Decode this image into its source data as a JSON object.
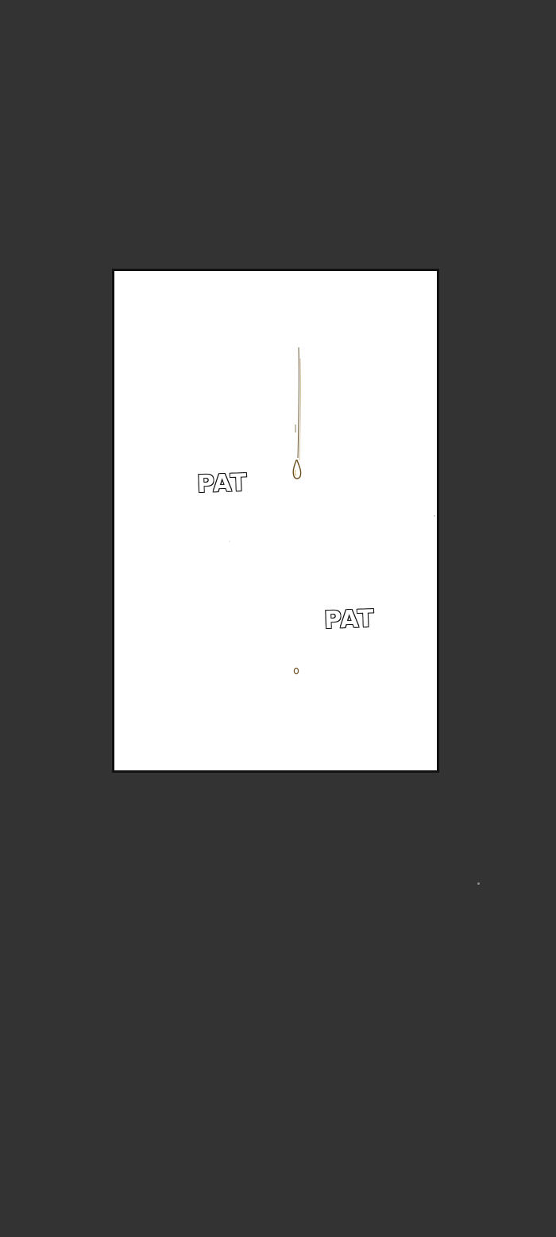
{
  "comic_panel": {
    "sfx": [
      "PAT",
      "PAT"
    ]
  },
  "colors": {
    "background": "#333333",
    "panel": "#ffffff",
    "panel_border": "#111111",
    "drip": "#8a6a2a"
  }
}
